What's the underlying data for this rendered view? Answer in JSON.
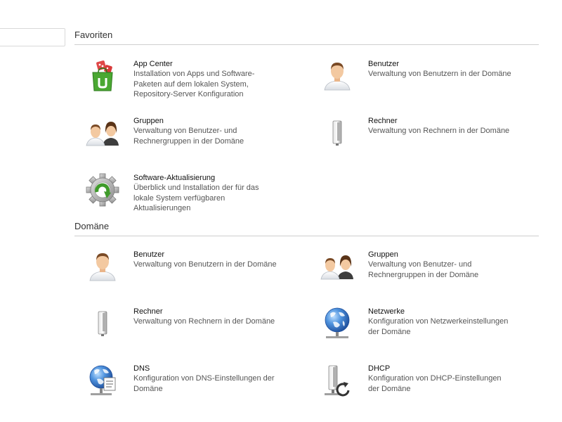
{
  "categories": [
    {
      "title": "Favoriten",
      "modules": [
        {
          "title": "App Center",
          "desc": "Installation von Apps und Software-\nPaketen auf dem lokalen System,\nRepository-Server Konfiguration",
          "icon": "app-center-icon"
        },
        {
          "title": "Benutzer",
          "desc": "Verwaltung von Benutzern in der Domäne",
          "icon": "user-icon"
        },
        {
          "title": "Gruppen",
          "desc": "Verwaltung von Benutzer- und\nRechnergruppen in der Domäne",
          "icon": "group-icon"
        },
        {
          "title": "Rechner",
          "desc": "Verwaltung von Rechnern in der Domäne",
          "icon": "computer-icon"
        },
        {
          "title": "Software-Aktualisierung",
          "desc": "Überblick und Installation der für das\nlokale System verfügbaren\nAktualisierungen",
          "icon": "software-update-icon"
        }
      ]
    },
    {
      "title": "Domäne",
      "modules": [
        {
          "title": "Benutzer",
          "desc": "Verwaltung von Benutzern in der Domäne",
          "icon": "user-icon"
        },
        {
          "title": "Gruppen",
          "desc": "Verwaltung von Benutzer- und\nRechnergruppen in der Domäne",
          "icon": "group-icon"
        },
        {
          "title": "Rechner",
          "desc": "Verwaltung von Rechnern in der Domäne",
          "icon": "computer-icon"
        },
        {
          "title": "Netzwerke",
          "desc": "Konfiguration von Netzwerkeinstellungen\nder Domäne",
          "icon": "network-icon"
        },
        {
          "title": "DNS",
          "desc": "Konfiguration von DNS-Einstellungen der\nDomäne",
          "icon": "dns-icon"
        },
        {
          "title": "DHCP",
          "desc": "Konfiguration von DHCP-Einstellungen\nder Domäne",
          "icon": "dhcp-icon"
        }
      ]
    }
  ],
  "colors": {
    "accent_green": "#3f9b2a",
    "globe_blue": "#2f6fc4",
    "skin": "#f3c9a1",
    "hair": "#7a4a25"
  }
}
